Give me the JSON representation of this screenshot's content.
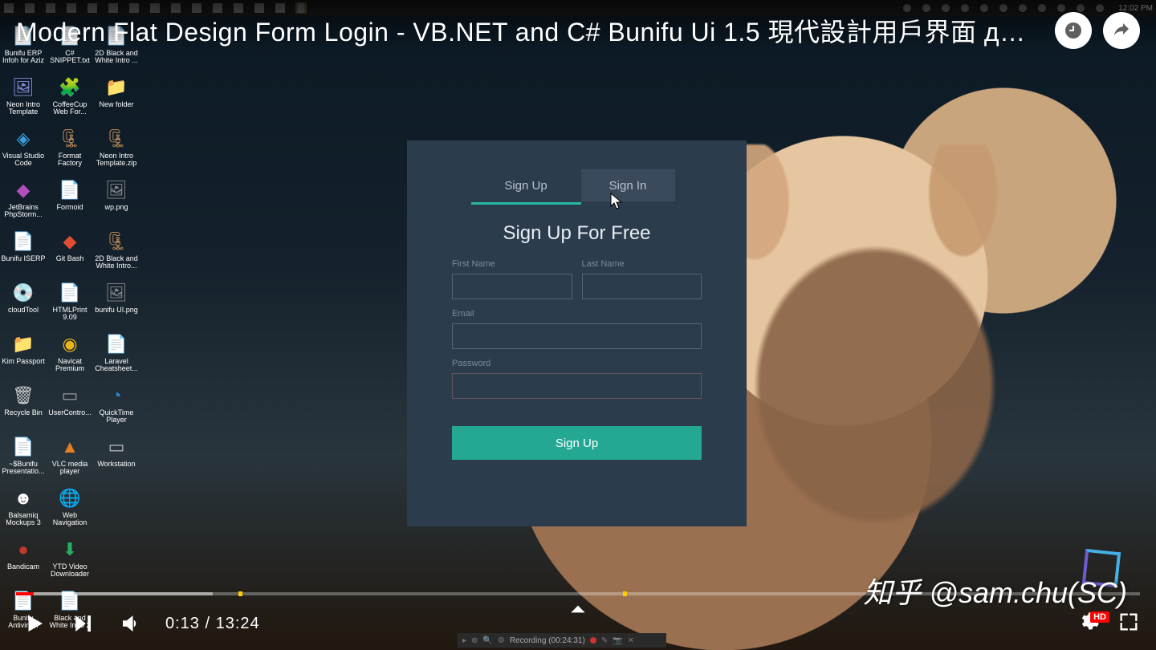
{
  "player": {
    "title": "Modern Flat Design Form Login - VB.NET and C# Bunifu Ui 1.5 現代設計用戶界面 для начина…",
    "current_time": "0:13",
    "duration": "13:24",
    "played_pct": 1.6,
    "buffered_pct": 17.5,
    "ad_markers_pct": [
      19.8,
      54.0
    ],
    "hd_label": "HD"
  },
  "taskbar": {
    "clock": "12:02 PM",
    "left_icons": [
      "windows",
      "tasks",
      "firefox",
      "vs",
      "file",
      "file",
      "gear",
      "vlc",
      "trash",
      "note",
      "folder",
      "screen",
      "edge",
      "word",
      "onenote"
    ],
    "tray_icons": [
      "chev",
      "net",
      "stop",
      "rec",
      "bat",
      "mon",
      "snd",
      "lan",
      "wifi",
      "msg",
      "act"
    ]
  },
  "desktop": {
    "rows": [
      [
        {
          "label": "Bunifu ERP Infoh for Aziz",
          "glyph": "📄",
          "color": "#fff"
        },
        {
          "label": "C# SNIPPET.txt",
          "glyph": "📄",
          "color": "#fff"
        },
        {
          "label": "2D Black and White Intro ...",
          "glyph": "📄",
          "color": "#fff"
        }
      ],
      [
        {
          "label": "Neon Intro Template",
          "glyph": "🖼",
          "color": "#88d"
        },
        {
          "label": "CoffeeCup Web For...",
          "glyph": "🧩",
          "color": "#c84"
        },
        {
          "label": "New folder",
          "glyph": "📁",
          "color": "#e2b33a"
        }
      ],
      [
        {
          "label": "Visual Studio Code",
          "glyph": "◈",
          "color": "#3b9cda"
        },
        {
          "label": "Format Factory",
          "glyph": "🗜",
          "color": "#c9935c"
        },
        {
          "label": "Neon Intro Template.zip",
          "glyph": "🗜",
          "color": "#c9935c"
        }
      ],
      [
        {
          "label": "JetBrains PhpStorm...",
          "glyph": "◆",
          "color": "#b24fbb"
        },
        {
          "label": "Formoid",
          "glyph": "📄",
          "color": "#fff"
        },
        {
          "label": "wp.png",
          "glyph": "🖼",
          "color": "#888"
        }
      ],
      [
        {
          "label": "Bunifu ISERP",
          "glyph": "📄",
          "color": "#fff"
        },
        {
          "label": "Git Bash",
          "glyph": "◆",
          "color": "#e24d31"
        },
        {
          "label": "2D Black and White Intro...",
          "glyph": "🗜",
          "color": "#c9935c"
        }
      ],
      [
        {
          "label": "cloudTool",
          "glyph": "💿",
          "color": "#bbb"
        },
        {
          "label": "HTMLPrint 9.09",
          "glyph": "📄",
          "color": "#fff"
        },
        {
          "label": "bunifu UI.png",
          "glyph": "🖼",
          "color": "#888"
        }
      ],
      [
        {
          "label": "Kim Passport",
          "glyph": "📁",
          "color": "#dedac2"
        },
        {
          "label": "Navicat Premium",
          "glyph": "◉",
          "color": "#e9b31a"
        },
        {
          "label": "Laravel Cheatsheet...",
          "glyph": "📄",
          "color": "#fff"
        }
      ],
      [
        {
          "label": "Recycle Bin",
          "glyph": "🗑",
          "color": "#ccc"
        },
        {
          "label": "UserContro...",
          "glyph": "▭",
          "color": "#999"
        },
        {
          "label": "QuickTime Player",
          "glyph": "◔",
          "color": "#2a8ad4"
        }
      ],
      [
        {
          "label": "~$Bunifu Presentatio...",
          "glyph": "📄",
          "color": "#fff"
        },
        {
          "label": "VLC media player",
          "glyph": "▲",
          "color": "#e67e22"
        },
        {
          "label": "Workstation",
          "glyph": "▭",
          "color": "#bbb"
        }
      ],
      [
        {
          "label": "Balsamiq Mockups 3",
          "glyph": "☻",
          "color": "#fff"
        },
        {
          "label": "Web Navigation",
          "glyph": "🌐",
          "color": "#3b9cda"
        },
        {
          "label": "",
          "glyph": "",
          "color": ""
        }
      ],
      [
        {
          "label": "Bandicam",
          "glyph": "●",
          "color": "#c0392b"
        },
        {
          "label": "YTD Video Downloader",
          "glyph": "⬇",
          "color": "#27ae60"
        },
        {
          "label": "",
          "glyph": "",
          "color": ""
        }
      ],
      [
        {
          "label": "Bunifu Antiviru...",
          "glyph": "📄",
          "color": "#fff"
        },
        {
          "label": "Black and White Intro 2",
          "glyph": "📄",
          "color": "#fff"
        },
        {
          "label": "",
          "glyph": "",
          "color": ""
        }
      ]
    ]
  },
  "form": {
    "tab_signup": "Sign Up",
    "tab_signin": "Sign In",
    "heading": "Sign Up For Free",
    "first_name_label": "First Name",
    "last_name_label": "Last  Name",
    "email_label": "Email",
    "password_label": "Password",
    "submit_label": "Sign Up"
  },
  "recording_bar": {
    "text": "Recording (00:24:31)"
  },
  "watermark": "知乎 @sam.chu(SC)"
}
